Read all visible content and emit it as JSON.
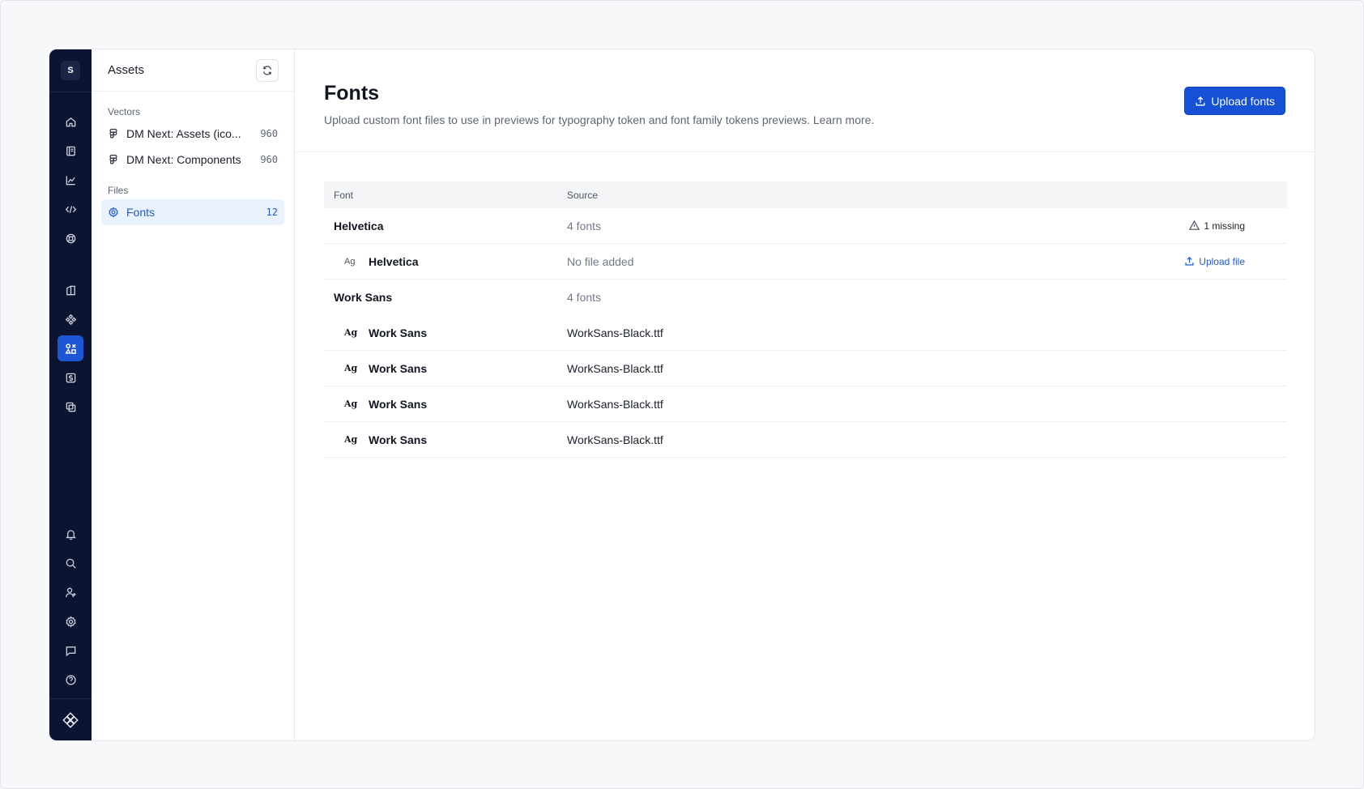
{
  "rail": {
    "workspace_initial": "S",
    "top_icons": [
      "home-icon",
      "book-icon",
      "chart-icon",
      "code-icon",
      "lifebuoy-icon"
    ],
    "mid_icons": [
      "documentation-icon",
      "components-icon",
      "assets-icon",
      "dollar-icon",
      "copy-icon"
    ],
    "bottom_icons": [
      "bell-icon",
      "search-icon",
      "user-plus-icon",
      "gear-icon",
      "chat-icon",
      "help-icon"
    ],
    "footer_icon": "brand-logo-icon"
  },
  "sidebar": {
    "title": "Assets",
    "sections": [
      {
        "label": "Vectors",
        "items": [
          {
            "label": "DM Next: Assets (ico...",
            "count": "960",
            "icon": "figma-icon"
          },
          {
            "label": "DM Next: Components",
            "count": "960",
            "icon": "figma-icon"
          }
        ]
      },
      {
        "label": "Files",
        "items": [
          {
            "label": "Fonts",
            "count": "12",
            "icon": "gear-icon",
            "active": true
          }
        ]
      }
    ]
  },
  "main": {
    "title": "Fonts",
    "subtitle": "Upload custom font files to use in previews for typography token and font family tokens previews. Learn more.",
    "upload_button": "Upload fonts",
    "table": {
      "headers": {
        "font": "Font",
        "source": "Source"
      },
      "rows": [
        {
          "type": "group",
          "font": "Helvetica",
          "source": "4 fonts",
          "status": "1 missing"
        },
        {
          "type": "child",
          "ag": "Ag",
          "font": "Helvetica",
          "source": "No file added",
          "action": "Upload file"
        },
        {
          "type": "group",
          "font": "Work Sans",
          "source": "4 fonts"
        },
        {
          "type": "child",
          "ag": "Ag",
          "font": "Work Sans",
          "source": "WorkSans-Black.ttf"
        },
        {
          "type": "child",
          "ag": "Ag",
          "font": "Work Sans",
          "source": "WorkSans-Black.ttf"
        },
        {
          "type": "child",
          "ag": "Ag",
          "font": "Work Sans",
          "source": "WorkSans-Black.ttf"
        },
        {
          "type": "child",
          "ag": "Ag",
          "font": "Work Sans",
          "source": "WorkSans-Black.ttf"
        }
      ]
    }
  },
  "colors": {
    "rail_bg": "#0b1430",
    "accent": "#1650d4",
    "active_item_bg": "#eaf2fd"
  }
}
